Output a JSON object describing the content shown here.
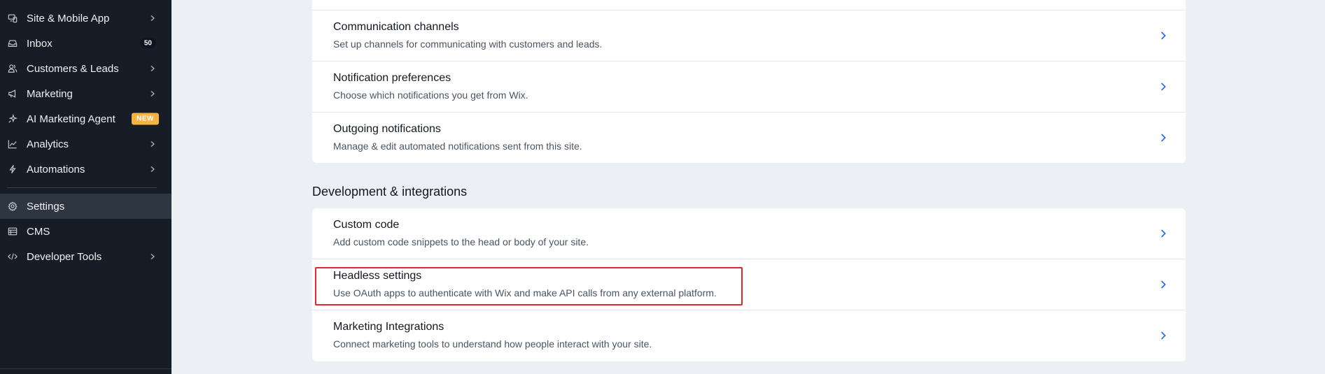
{
  "sidebar": {
    "items": [
      {
        "label": "Site & Mobile App",
        "icon": "devices-icon",
        "chevron": true
      },
      {
        "label": "Inbox",
        "icon": "inbox-icon",
        "badge": "50"
      },
      {
        "label": "Customers & Leads",
        "icon": "customers-icon",
        "chevron": true
      },
      {
        "label": "Marketing",
        "icon": "megaphone-icon",
        "chevron": true
      },
      {
        "label": "AI Marketing Agent",
        "icon": "sparkle-icon",
        "badge_new": "NEW"
      },
      {
        "label": "Analytics",
        "icon": "analytics-icon",
        "chevron": true
      },
      {
        "label": "Automations",
        "icon": "lightning-icon",
        "chevron": true
      },
      {
        "label": "Settings",
        "icon": "gear-icon",
        "active": true
      },
      {
        "label": "CMS",
        "icon": "cms-icon"
      },
      {
        "label": "Developer Tools",
        "icon": "code-icon",
        "chevron": true
      }
    ]
  },
  "main": {
    "top_card": {
      "rows": [
        {
          "title": "Communication channels",
          "desc": "Set up channels for communicating with customers and leads."
        },
        {
          "title": "Notification preferences",
          "desc": "Choose which notifications you get from Wix."
        },
        {
          "title": "Outgoing notifications",
          "desc": "Manage & edit automated notifications sent from this site."
        }
      ]
    },
    "section_title": "Development & integrations",
    "dev_card": {
      "rows": [
        {
          "title": "Custom code",
          "desc": "Add custom code snippets to the head or body of your site."
        },
        {
          "title": "Headless settings",
          "desc": "Use OAuth apps to authenticate with Wix and make API calls from any external platform."
        },
        {
          "title": "Marketing Integrations",
          "desc": "Connect marketing tools to understand how people interact with your site."
        }
      ]
    }
  },
  "colors": {
    "sidebar_bg": "#161d27",
    "accent": "#1c6bf0",
    "highlight": "#e3262d",
    "badge_new": "#f6b33d"
  }
}
